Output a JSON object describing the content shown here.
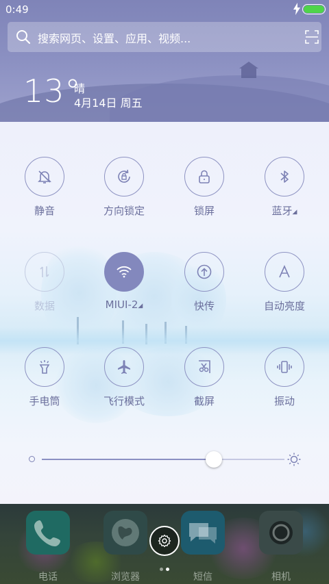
{
  "status_bar": {
    "time": "0:49"
  },
  "search": {
    "placeholder": "搜索网页、设置、应用、视频..."
  },
  "weather": {
    "temperature": "13°",
    "condition": "晴",
    "date": "4月14日 周五"
  },
  "toggles": [
    {
      "label": "静音",
      "icon": "bell-off-icon",
      "active": false
    },
    {
      "label": "方向锁定",
      "icon": "rotation-lock-icon",
      "active": false
    },
    {
      "label": "锁屏",
      "icon": "lock-icon",
      "active": false
    },
    {
      "label": "蓝牙",
      "icon": "bluetooth-icon",
      "active": false,
      "has_submenu": true
    },
    {
      "label": "数据",
      "icon": "mobile-data-icon",
      "active": false,
      "disabled": true
    },
    {
      "label": "MIUI-2",
      "icon": "wifi-icon",
      "active": true,
      "has_submenu": true
    },
    {
      "label": "快传",
      "icon": "quick-transfer-icon",
      "active": false
    },
    {
      "label": "自动亮度",
      "icon": "auto-brightness-icon",
      "active": false
    },
    {
      "label": "手电筒",
      "icon": "flashlight-icon",
      "active": false
    },
    {
      "label": "飞行模式",
      "icon": "airplane-icon",
      "active": false
    },
    {
      "label": "截屏",
      "icon": "screenshot-icon",
      "active": false
    },
    {
      "label": "振动",
      "icon": "vibrate-icon",
      "active": false
    }
  ],
  "brightness": {
    "level_percent": 71
  },
  "dock": {
    "apps": [
      {
        "name": "电话",
        "icon": "phone-icon"
      },
      {
        "name": "浏览器",
        "icon": "browser-icon"
      },
      {
        "name": "短信",
        "icon": "messages-icon"
      },
      {
        "name": "相机",
        "icon": "camera-icon"
      }
    ],
    "page_count": 2,
    "current_page": 2
  },
  "colors": {
    "accent": "#8388bd",
    "header": "#8a8fc1",
    "battery": "#4fd44a"
  }
}
